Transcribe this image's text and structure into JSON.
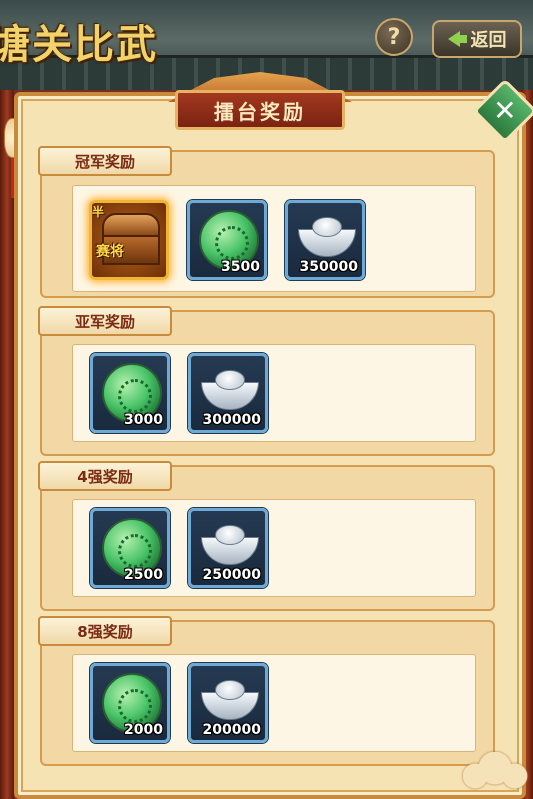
{
  "background": {
    "event_title": "塘关比武",
    "help_label": "?",
    "back_label": "返回"
  },
  "panel": {
    "title": "擂台奖励",
    "close_label": "✕"
  },
  "sections": [
    {
      "title": "冠军奖励",
      "items": [
        {
          "icon": "treasure-chest-icon",
          "corner_label": "半",
          "tag": "赛将",
          "count": ""
        },
        {
          "icon": "jade-coin-icon",
          "count": "3500"
        },
        {
          "icon": "silver-ingot-icon",
          "count": "350000"
        }
      ]
    },
    {
      "title": "亚军奖励",
      "items": [
        {
          "icon": "jade-coin-icon",
          "count": "3000"
        },
        {
          "icon": "silver-ingot-icon",
          "count": "300000"
        }
      ]
    },
    {
      "title": "4强奖励",
      "items": [
        {
          "icon": "jade-coin-icon",
          "count": "2500"
        },
        {
          "icon": "silver-ingot-icon",
          "count": "250000"
        }
      ]
    },
    {
      "title": "8强奖励",
      "items": [
        {
          "icon": "jade-coin-icon",
          "count": "2000"
        },
        {
          "icon": "silver-ingot-icon",
          "count": "200000"
        }
      ]
    }
  ],
  "colors": {
    "panel_bg": "#f6e3b4",
    "panel_border": "#c98a3c",
    "tab_text": "#7a2a12",
    "close_green": "#2c7a3d",
    "item_frame": "#6fa9d6",
    "gold_glow": "#ffae2a"
  }
}
